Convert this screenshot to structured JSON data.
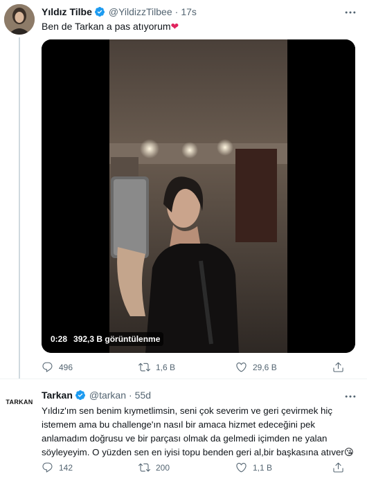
{
  "tweet1": {
    "name": "Yıldız Tilbe",
    "handle": "@YildizzTilbee",
    "dot": "·",
    "time": "17s",
    "text": "Ben de Tarkan a pas atıyorum",
    "emoji": "❤",
    "video": {
      "duration": "0:28",
      "views": "392,3 B görüntülenme"
    },
    "actions": {
      "replies": "496",
      "retweets": "1,6 B",
      "likes": "29,6 B"
    }
  },
  "tweet2": {
    "name": "Tarkan",
    "handle": "@tarkan",
    "dot": "·",
    "time": "55d",
    "avatar_text": "TARKAN",
    "text": "Yıldız'ım sen benim kıymetlimsin, seni çok severim ve geri çevirmek hiç istemem ama bu challenge'ın nasıl bir amaca hizmet edeceğini pek anlamadım doğrusu ve bir parçası olmak da gelmedi içimden ne yalan söyleyeyim. O yüzden sen en iyisi topu benden geri al,bir başkasına atıver",
    "emoji": "😘",
    "actions": {
      "replies": "142",
      "retweets": "200",
      "likes": "1,1 B"
    }
  },
  "colors": {
    "verified": "#1d9bf0",
    "secondary_text": "#536471",
    "heart": "#e0245e"
  }
}
